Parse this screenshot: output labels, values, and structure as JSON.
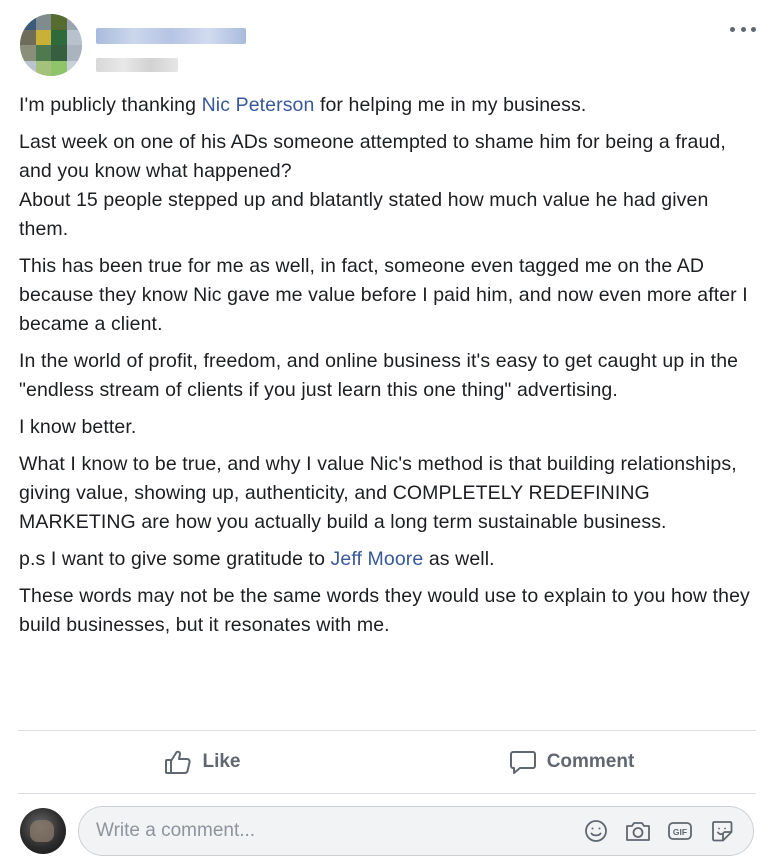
{
  "post": {
    "author_name": "",
    "paragraphs": [
      [
        {
          "text": "I'm publicly thanking "
        },
        {
          "text": "Nic Peterson",
          "mention": true
        },
        {
          "text": " for helping me in my business."
        }
      ],
      [
        {
          "text": "Last week on one of his ADs someone attempted to shame him for being a fraud, and you know what happened?\nAbout 15 people stepped up and blatantly stated how much value he had given them."
        }
      ],
      [
        {
          "text": "This has been true for me as well, in fact, someone even tagged me on the AD because they know Nic gave me value before I paid him, and now even more after I became a client."
        }
      ],
      [
        {
          "text": "In the world of profit, freedom, and online business it's easy to get caught up in the \"endless stream of clients if you just learn this one thing\" advertising."
        }
      ],
      [
        {
          "text": "I know better."
        }
      ],
      [
        {
          "text": "What I know to be true, and why I value Nic's method is that building relationships, giving value, showing up, authenticity, and COMPLETELY REDEFINING MARKETING are how you actually build a long term sustainable business."
        }
      ],
      [
        {
          "text": "p.s I want to give some gratitude to "
        },
        {
          "text": "Jeff Moore",
          "mention": true
        },
        {
          "text": " as well."
        }
      ],
      [
        {
          "text": "These words may not be the same words they would use to explain to you how they build businesses, but it resonates with me."
        }
      ]
    ]
  },
  "actions": {
    "like_label": "Like",
    "comment_label": "Comment"
  },
  "comment_box": {
    "placeholder": "Write a comment..."
  },
  "icons": {
    "more": "more-options-icon",
    "like": "thumbs-up-icon",
    "comment": "speech-bubble-icon",
    "emoji": "smiley-icon",
    "camera": "camera-icon",
    "gif": "gif-icon",
    "sticker": "sticker-icon"
  },
  "colors": {
    "mention": "#385898",
    "action_text": "#606770",
    "divider": "#dadde1",
    "comment_box_bg": "#f2f3f5"
  }
}
